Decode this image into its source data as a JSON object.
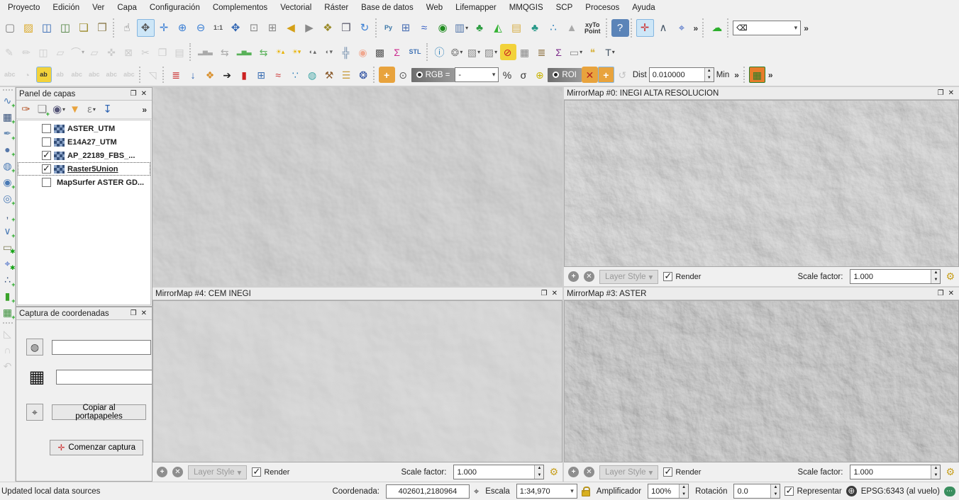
{
  "menu": [
    "Proyecto",
    "Edición",
    "Ver",
    "Capa",
    "Configuración",
    "Complementos",
    "Vectorial",
    "Ráster",
    "Base de datos",
    "Web",
    "Lifemapper",
    "MMQGIS",
    "SCP",
    "Procesos",
    "Ayuda"
  ],
  "misc": {
    "chevrons": "»",
    "float_glyph": "❐",
    "close_glyph": "✕",
    "caret": "▾",
    "search_clear_glyph": "⌫"
  },
  "tb1": {
    "project": [
      {
        "n": "new-project-icon",
        "g": "▢",
        "c": "#777"
      },
      {
        "n": "open-project-icon",
        "g": "▨",
        "c": "#dba928"
      },
      {
        "n": "save-project-icon",
        "g": "◫",
        "c": "#2e64b2"
      },
      {
        "n": "save-project-as-icon",
        "g": "◫",
        "c": "#4a7f3a"
      },
      {
        "n": "new-composer-icon",
        "g": "❏",
        "c": "#9a8a28"
      },
      {
        "n": "composer-manager-icon",
        "g": "❐",
        "c": "#8a7a4a"
      }
    ],
    "nav": [
      {
        "n": "touch-zoom-icon",
        "g": "☝",
        "c": "#666"
      },
      {
        "n": "pan-map-icon",
        "g": "✥",
        "c": "#555",
        "a": 1
      },
      {
        "n": "pan-to-selection-icon",
        "g": "✛",
        "c": "#3b7fd4"
      },
      {
        "n": "zoom-in-icon",
        "g": "⊕",
        "c": "#3b7fd4"
      },
      {
        "n": "zoom-out-icon",
        "g": "⊖",
        "c": "#3b7fd4"
      },
      {
        "n": "zoom-native-icon",
        "g": "1:1",
        "c": "#555",
        "t": 1
      },
      {
        "n": "zoom-full-icon",
        "g": "✥",
        "c": "#2e64b2"
      },
      {
        "n": "zoom-to-selection-icon",
        "g": "⊡",
        "c": "#888"
      },
      {
        "n": "zoom-to-layer-icon",
        "g": "⊞",
        "c": "#888"
      },
      {
        "n": "zoom-last-icon",
        "g": "◀",
        "c": "#d4a017"
      },
      {
        "n": "zoom-next-icon",
        "g": "▶",
        "c": "#8a8a8a"
      },
      {
        "n": "new-bookmark-icon",
        "g": "❖",
        "c": "#9a8a28"
      },
      {
        "n": "show-bookmarks-icon",
        "g": "❒",
        "c": "#556"
      },
      {
        "n": "refresh-icon",
        "g": "↻",
        "c": "#3b7fd4"
      }
    ],
    "plugins": [
      {
        "n": "python-console-icon",
        "g": "Py",
        "c": "#3b77a8",
        "t": 1
      },
      {
        "n": "grid-calc-icon",
        "g": "⊞",
        "c": "#4a6fb3"
      },
      {
        "n": "osgeo-wave-icon",
        "g": "≈",
        "c": "#3b62c4"
      },
      {
        "n": "radio-tower-icon",
        "g": "◉",
        "c": "#1f8c1f"
      },
      {
        "n": "image-writer-icon",
        "g": "▥",
        "c": "#5577aa",
        "v": "▾"
      },
      {
        "n": "leaf-icon",
        "g": "♣",
        "c": "#2f9e44"
      },
      {
        "n": "dem-sun-icon",
        "g": "◭",
        "c": "#35b335"
      },
      {
        "n": "archive-icon",
        "g": "▤",
        "c": "#d8b04a"
      },
      {
        "n": "globe-leaf-icon",
        "g": "♣",
        "c": "#2a9a8a"
      },
      {
        "n": "cluster-dots-icon",
        "g": "∴",
        "c": "#2c7fb8"
      },
      {
        "n": "mountain-icon",
        "g": "▲",
        "c": "#aaa"
      },
      {
        "n": "xyto-point-icon",
        "g": "xyTo\nPoint",
        "c": "#333",
        "t": 1
      }
    ],
    "help": [
      {
        "n": "help-icon",
        "g": "?",
        "c": "#fff",
        "bg": "#5b84b8"
      }
    ],
    "capture": [
      {
        "n": "coordinate-capture-icon",
        "g": "✛",
        "c": "#c33",
        "a": 1
      },
      {
        "n": "caliper-icon",
        "g": "∧",
        "c": "#456"
      },
      {
        "n": "gps-connect-icon",
        "g": "⌖",
        "c": "#3b62c4"
      }
    ],
    "cloud": [
      {
        "n": "cloud-icon",
        "g": "☁",
        "c": "#2daf2d"
      }
    ]
  },
  "tb2": {
    "digitize": [
      {
        "n": "current-edits-icon",
        "g": "✎",
        "c": "#999",
        "d": 1
      },
      {
        "n": "toggle-editing-icon",
        "g": "✏",
        "c": "#999",
        "d": 1
      },
      {
        "n": "save-edits-icon",
        "g": "◫",
        "c": "#999",
        "d": 1
      },
      {
        "n": "capture-polygon-icon",
        "g": "▱",
        "c": "#999",
        "d": 1
      },
      {
        "n": "node-tool-icon",
        "g": "⌒",
        "c": "#999",
        "d": 1,
        "v": "▾"
      },
      {
        "n": "move-feature-icon",
        "g": "▱",
        "c": "#999",
        "d": 1
      },
      {
        "n": "vertex-edit-icon",
        "g": "✜",
        "c": "#999",
        "d": 1
      },
      {
        "n": "delete-selected-icon",
        "g": "⊠",
        "c": "#999",
        "d": 1
      },
      {
        "n": "cut-features-icon",
        "g": "✂",
        "c": "#999",
        "d": 1
      },
      {
        "n": "copy-features-icon",
        "g": "❐",
        "c": "#999",
        "d": 1
      },
      {
        "n": "paste-features-icon",
        "g": "▤",
        "c": "#999",
        "d": 1
      }
    ],
    "raster": [
      {
        "n": "histogram-full-icon",
        "g": "▂▅▃",
        "c": "#aaa",
        "t": 1
      },
      {
        "n": "histogram-stretch-icon",
        "g": "⇆",
        "c": "#aaa"
      },
      {
        "n": "histogram-local-icon",
        "g": "▂▅▃",
        "c": "#58b158",
        "t": 1
      },
      {
        "n": "histogram-local-stretch-icon",
        "g": "⇆",
        "c": "#58b158"
      },
      {
        "n": "brightness-up-icon",
        "g": "☀▴",
        "c": "#e8b200",
        "t": 1
      },
      {
        "n": "brightness-down-icon",
        "g": "☀▾",
        "c": "#e8b200",
        "t": 1
      },
      {
        "n": "contrast-up-icon",
        "g": "◐▴",
        "c": "#666",
        "t": 1
      },
      {
        "n": "contrast-down-icon",
        "g": "◐▾",
        "c": "#666",
        "t": 1
      },
      {
        "n": "grid-lines-icon",
        "g": "╬",
        "c": "#6a87a8"
      },
      {
        "n": "glow-icon",
        "g": "◉",
        "c": "#f0a890"
      },
      {
        "n": "pansharpen-icon",
        "g": "▩",
        "c": "#555"
      },
      {
        "n": "sum-bands-icon",
        "g": "Σ",
        "c": "#cc2a8e"
      },
      {
        "n": "stl-icon",
        "g": "STL",
        "c": "#3b6fb3",
        "t": 1
      }
    ],
    "attr": [
      {
        "n": "identify-icon",
        "g": "ⓘ",
        "c": "#2c7fb8"
      },
      {
        "n": "run-action-icon",
        "g": "❂",
        "c": "#888",
        "v": "▾"
      },
      {
        "n": "select-features-icon",
        "g": "▧",
        "c": "#888",
        "v": "▾"
      },
      {
        "n": "deselect-icon",
        "g": "▨",
        "c": "#888",
        "v": "▾"
      },
      {
        "n": "select-by-value-icon",
        "g": "⊘",
        "c": "#cc2222",
        "bg": "#f2d23a"
      },
      {
        "n": "attribute-table-icon",
        "g": "▦",
        "c": "#888"
      },
      {
        "n": "abacus-icon",
        "g": "≣",
        "c": "#8a6d3b"
      },
      {
        "n": "statistics-icon",
        "g": "Σ",
        "c": "#7d2b8b"
      },
      {
        "n": "measure-icon",
        "g": "▭",
        "c": "#888",
        "v": "▾"
      },
      {
        "n": "maptips-icon",
        "g": "❝",
        "c": "#d8b545"
      },
      {
        "n": "text-annotation-icon",
        "g": "T",
        "c": "#456",
        "v": "▾"
      }
    ]
  },
  "tb3": {
    "labels": [
      {
        "n": "label-abc-icon",
        "g": "abc",
        "c": "#999",
        "t": 1,
        "d": 1
      },
      {
        "n": "label-pie-icon",
        "g": "◔",
        "c": "#aaa",
        "d": 1
      },
      {
        "n": "label-highlight-icon",
        "g": "ab",
        "c": "#333",
        "t": 1,
        "bg": "#f2d23a",
        "a": 1
      },
      {
        "n": "label-pin-icon",
        "g": "ab",
        "c": "#999",
        "t": 1,
        "d": 1
      },
      {
        "n": "label-show-hide-icon",
        "g": "abc",
        "c": "#999",
        "t": 1,
        "d": 1
      },
      {
        "n": "label-move-icon",
        "g": "abc",
        "c": "#999",
        "t": 1,
        "d": 1
      },
      {
        "n": "label-rotate-icon",
        "g": "abc",
        "c": "#999",
        "t": 1,
        "d": 1
      },
      {
        "n": "label-properties-icon",
        "g": "abc",
        "c": "#999",
        "t": 1,
        "d": 1
      }
    ],
    "callout": [
      {
        "n": "callout-icon",
        "g": "◹",
        "c": "#999",
        "d": 1
      }
    ],
    "scp": [
      {
        "n": "band-set-icon",
        "g": "≣",
        "c": "#cc3333"
      },
      {
        "n": "download-products-icon",
        "g": "↓",
        "c": "#2e64b2"
      },
      {
        "n": "cluster-icon",
        "g": "❖",
        "c": "#d98f2b"
      },
      {
        "n": "input-arrow-icon",
        "g": "➔",
        "c": "#222"
      },
      {
        "n": "band-panel-icon",
        "g": "▮",
        "c": "#cc2222"
      },
      {
        "n": "band-calc-icon",
        "g": "⊞",
        "c": "#3b6fb3"
      },
      {
        "n": "spectral-plot-icon",
        "g": "≈",
        "c": "#cc3333"
      },
      {
        "n": "scatter-plot-icon",
        "g": "∵",
        "c": "#2c7fb8"
      },
      {
        "n": "donut-chart-icon",
        "g": "◍",
        "c": "#3aa3a3"
      },
      {
        "n": "tools-icon",
        "g": "⚒",
        "c": "#8a5a2b"
      },
      {
        "n": "manual-book-icon",
        "g": "☰",
        "c": "#c89b3c"
      },
      {
        "n": "settings-gear-icon",
        "g": "❂",
        "c": "#2a4da0"
      }
    ],
    "rgb_label": "RGB =",
    "rgb_value": "-",
    "roi_label": "ROI",
    "dist_label": "Dist",
    "dist_value": "0.010000",
    "min_label": "Min"
  },
  "leftbar_a": [
    {
      "n": "add-vector-layer-icon",
      "g": "∿",
      "c": "#4a7ab5",
      "b": "+"
    },
    {
      "n": "add-raster-layer-icon",
      "g": "▦",
      "c": "#35507a",
      "b": "+"
    },
    {
      "n": "add-spatialite-layer-icon",
      "g": "✒",
      "c": "#6a8db5",
      "b": "+"
    },
    {
      "n": "add-postgis-layer-icon",
      "g": "●",
      "c": "#5577aa",
      "b": "+",
      "v": "▾"
    },
    {
      "n": "add-wms-layer-icon",
      "g": "◍",
      "c": "#4a7ab5",
      "b": "+",
      "v": "▾"
    },
    {
      "n": "add-wcs-layer-icon",
      "g": "◉",
      "c": "#4a7ab5",
      "b": "+"
    },
    {
      "n": "add-wfs-layer-icon",
      "g": "◎",
      "c": "#4a7ab5",
      "b": "+",
      "v": "▾"
    },
    {
      "n": "add-delimited-text-icon",
      "g": ",",
      "c": "#35507a",
      "t": 1,
      "b": "+"
    },
    {
      "n": "add-virtual-layer-icon",
      "g": "∨",
      "c": "#4a7ab5",
      "b": "+"
    },
    {
      "n": "add-chip-layer-icon",
      "g": "▭",
      "c": "#7a7a52",
      "b": "✱",
      "v": "▾"
    },
    {
      "n": "gps-tools-icon",
      "g": "⌖",
      "c": "#3b62c4",
      "b": "✱"
    },
    {
      "n": "add-oracle-layer-icon",
      "g": "∴",
      "c": "#35507a",
      "b": "+"
    },
    {
      "n": "add-mssql-layer-icon",
      "g": "▮",
      "c": "#3aa32a",
      "b": "+"
    },
    {
      "n": "add-table-icon",
      "g": "▦",
      "c": "#3a8f3a",
      "b": "+"
    }
  ],
  "leftbar_b": [
    {
      "n": "measure-angle-icon",
      "g": "◺",
      "c": "#999",
      "d": 1
    },
    {
      "n": "snapping-magnet-icon",
      "g": "∩",
      "c": "#999",
      "d": 1
    },
    {
      "n": "undo-icon",
      "g": "↶",
      "c": "#999",
      "d": 1
    }
  ],
  "layers_panel": {
    "title": "Panel de capas",
    "toolbar": [
      {
        "n": "style-manager-icon",
        "g": "✑",
        "c": "#b5562a"
      },
      {
        "n": "add-group-icon",
        "g": "❏",
        "c": "#888",
        "b": "+"
      },
      {
        "n": "manage-visibility-icon",
        "g": "◉",
        "c": "#557",
        "v": "▾"
      },
      {
        "n": "filter-legend-icon",
        "g": "▼",
        "c": "#e8a33d"
      },
      {
        "n": "expression-filter-icon",
        "g": "ε",
        "c": "#888",
        "v": "▾"
      },
      {
        "n": "expand-collapse-icon",
        "g": "↧",
        "c": "#2e64b2"
      }
    ],
    "layers": [
      {
        "label": "ASTER_UTM",
        "checked": false,
        "thumb": true
      },
      {
        "label": "E14A27_UTM",
        "checked": false,
        "thumb": true
      },
      {
        "label": "AP_22189_FBS_...",
        "checked": true,
        "thumb": true
      },
      {
        "label": "Raster5Union",
        "checked": true,
        "thumb": true,
        "selected": true
      },
      {
        "label": "MapSurfer ASTER GD...",
        "checked": false,
        "thumb": false
      }
    ]
  },
  "coord_panel": {
    "title": "Captura de coordenadas",
    "crs_value": "",
    "grid_value": "",
    "copy_label": "Copiar al portapapeles",
    "start_label": "Comenzar captura",
    "globe_glyph": "◍",
    "grid_glyph": "▦",
    "mouse_glyph": "⌖",
    "start_glyph": "✛"
  },
  "mirrors": {
    "m0_title": "MirrorMap #0: INEGI ALTA RESOLUCION",
    "m4_title": "MirrorMap #4: CEM INEGI",
    "m3_title": "MirrorMap #3: ASTER",
    "controls": {
      "add_glyph": "+",
      "close_glyph": "✕",
      "layer_style": "Layer Style",
      "caret": "▾",
      "render_label": "Render",
      "render_checked": true,
      "scale_label": "Scale factor:",
      "scale_value": "1.000",
      "wrench_glyph": "⚙"
    }
  },
  "status": {
    "message": "Updated local data sources",
    "coord_label": "Coordenada:",
    "coord_value": "402601,2180964",
    "mouse_glyph": "⌖",
    "scale_label": "Escala",
    "scale_value": "1:34,970",
    "magnifier_label": "Amplificador",
    "magnifier_value": "100%",
    "rotation_label": "Rotación",
    "rotation_value": "0.0",
    "render_label": "Representar",
    "render_checked": true,
    "crs_glyph": "⊕",
    "crs_label": "EPSG:6343 (al vuelo)",
    "chat_glyph": "⋯"
  }
}
